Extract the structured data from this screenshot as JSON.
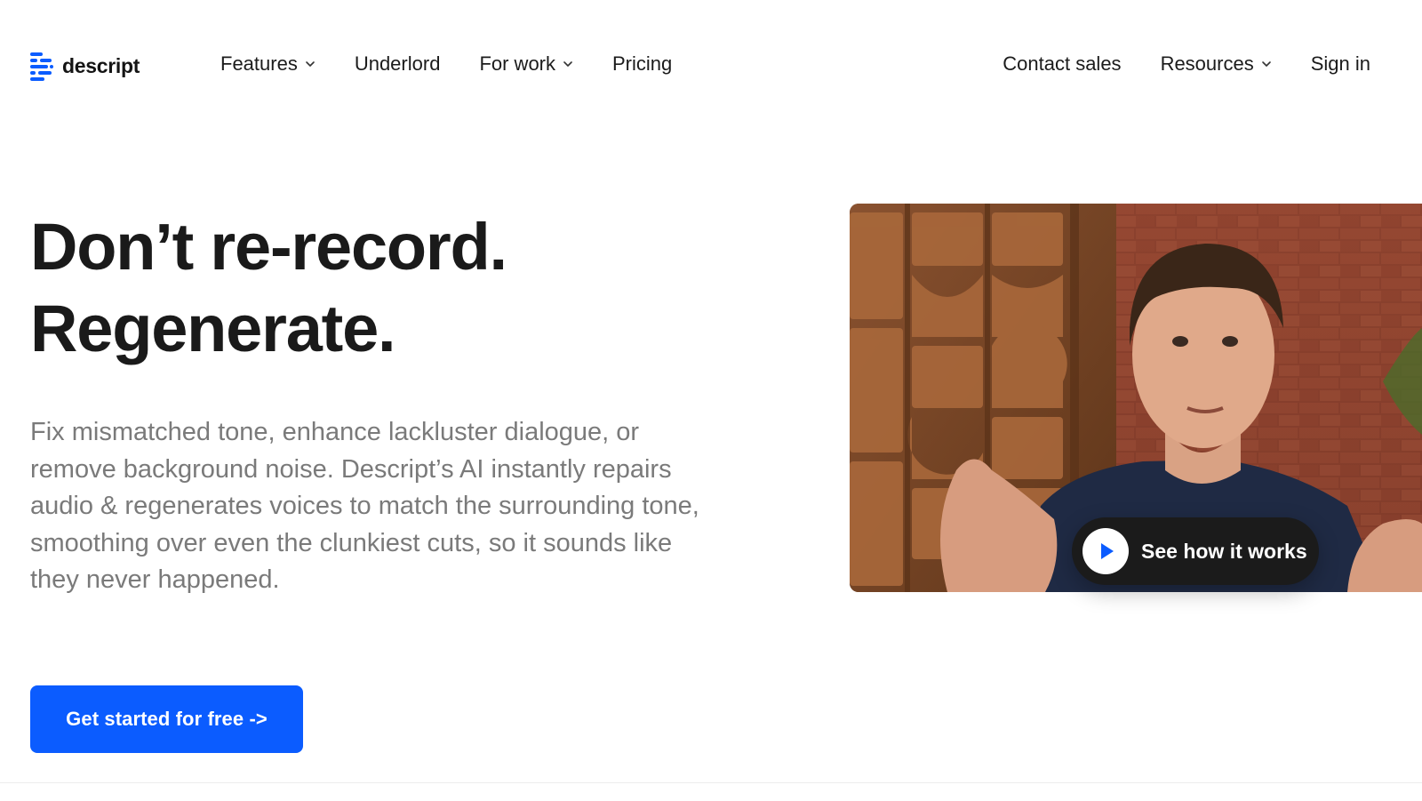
{
  "brand": {
    "name": "descript",
    "accent": "#0b5cff"
  },
  "nav": {
    "left": [
      {
        "label": "Features",
        "dropdown": true
      },
      {
        "label": "Underlord",
        "dropdown": false
      },
      {
        "label": "For work",
        "dropdown": true
      },
      {
        "label": "Pricing",
        "dropdown": false
      }
    ],
    "right": [
      {
        "label": "Contact sales",
        "dropdown": false
      },
      {
        "label": "Resources",
        "dropdown": true
      },
      {
        "label": "Sign in",
        "dropdown": false
      }
    ]
  },
  "hero": {
    "headline_line1": "Don’t re-record.",
    "headline_line2": "Regenerate.",
    "body": "Fix mismatched tone, enhance lackluster dialogue, or remove background noise. Descript’s AI instantly repairs audio & regenerates voices to match the surrounding tone, smoothing over even the clunkiest cuts, so it sounds like they never happened.",
    "cta_label": "Get started for free ->"
  },
  "video": {
    "play_label": "See how it works",
    "play_icon": "play-icon"
  }
}
